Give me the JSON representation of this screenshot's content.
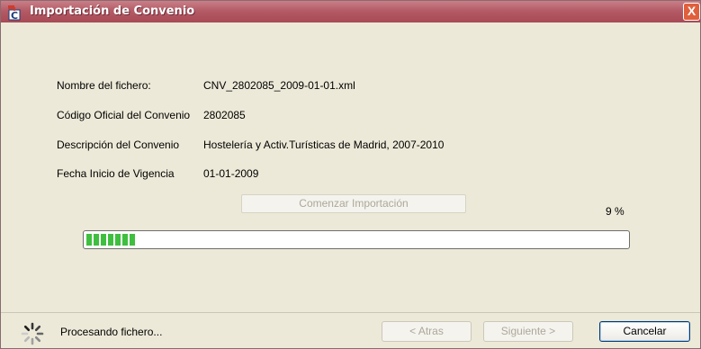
{
  "window": {
    "title": "Importación de Convenio",
    "close_label": "X"
  },
  "fields": [
    {
      "label": "Nombre del fichero:",
      "value": "CNV_2802085_2009-01-01.xml"
    },
    {
      "label": "Código Oficial del Convenio",
      "value": "2802085"
    },
    {
      "label": "Descripción del Convenio",
      "value": "Hostelería y Activ.Turísticas de Madrid, 2007-2010"
    },
    {
      "label": "Fecha Inicio de Vigencia",
      "value": "01-01-2009"
    }
  ],
  "start_button_label": "Comenzar Importación",
  "progress": {
    "percent_text": "9 %",
    "fraction": 0.09
  },
  "status": {
    "text": "Procesando fichero..."
  },
  "buttons": {
    "back": "< Atras",
    "next": "Siguiente >",
    "cancel": "Cancelar"
  },
  "colors": {
    "title_bar": "#b35b66",
    "progress_fill": "#3fbf3f"
  }
}
